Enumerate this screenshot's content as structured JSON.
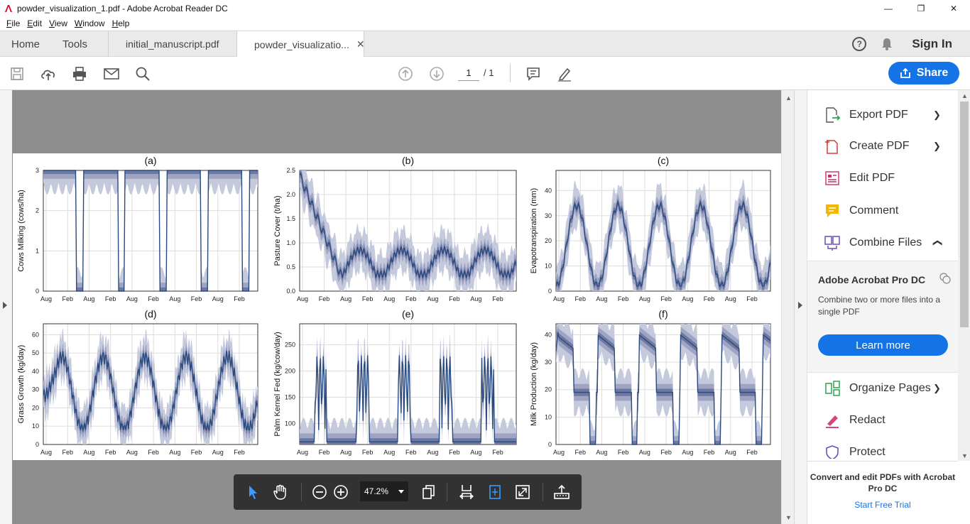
{
  "window": {
    "title": "powder_visualization_1.pdf - Adobe Acrobat Reader DC",
    "minimize": "—",
    "restore": "❐",
    "close": "✕"
  },
  "menu": [
    {
      "label": "File",
      "key": "F",
      "rest": "ile"
    },
    {
      "label": "Edit",
      "key": "E",
      "rest": "dit"
    },
    {
      "label": "View",
      "key": "V",
      "rest": "iew"
    },
    {
      "label": "Window",
      "key": "W",
      "rest": "indow"
    },
    {
      "label": "Help",
      "key": "H",
      "rest": "elp"
    }
  ],
  "tabs": {
    "home": "Home",
    "tools": "Tools",
    "doc1": "initial_manuscript.pdf",
    "doc2": "powder_visualizatio...",
    "doc2_close": "✕"
  },
  "header_right": {
    "help": "?",
    "sign_in": "Sign In"
  },
  "toolbar": {
    "page_current": "1",
    "page_total": "/ 1",
    "share_label": "Share"
  },
  "floatbar": {
    "zoom": "47.2%"
  },
  "right_pane": {
    "items": [
      {
        "label": "Export PDF",
        "icon": "export-pdf-icon",
        "chevron": "down"
      },
      {
        "label": "Create PDF",
        "icon": "create-pdf-icon",
        "chevron": "down"
      },
      {
        "label": "Edit PDF",
        "icon": "edit-pdf-icon"
      },
      {
        "label": "Comment",
        "icon": "comment-icon"
      },
      {
        "label": "Combine Files",
        "icon": "combine-files-icon",
        "chevron": "up"
      },
      {
        "label": "Organize Pages",
        "icon": "organize-pages-icon",
        "chevron": "down"
      },
      {
        "label": "Redact",
        "icon": "redact-icon"
      },
      {
        "label": "Protect",
        "icon": "protect-icon"
      }
    ],
    "promo_title": "Adobe Acrobat Pro DC",
    "promo_desc": "Combine two or more files into a single PDF",
    "promo_button": "Learn more",
    "bottom_text": "Convert and edit PDFs with Acrobat Pro DC",
    "bottom_link": "Start Free Trial"
  },
  "colors": {
    "accent": "#1473e6",
    "line": "#2a4a7f",
    "band_light": "#c5c9dc",
    "band_mid": "#9ea5c4",
    "band_dark": "#6f789f"
  },
  "chart_data": [
    {
      "type": "line",
      "panel": "(a)",
      "ylabel": "Cows Milking (cows/ha)",
      "x_ticks": [
        "Aug",
        "Feb",
        "Aug",
        "Feb",
        "Aug",
        "Feb",
        "Aug",
        "Feb",
        "Aug",
        "Feb"
      ],
      "y_ticks": [
        "0",
        "1",
        "2",
        "3"
      ],
      "ylim": [
        0,
        3
      ],
      "pattern": "cows",
      "shaded_bands": true
    },
    {
      "type": "line",
      "panel": "(b)",
      "ylabel": "Pasture Cover (t/ha)",
      "x_ticks": [
        "Aug",
        "Feb",
        "Aug",
        "Feb",
        "Aug",
        "Feb",
        "Aug",
        "Feb",
        "Aug",
        "Feb"
      ],
      "y_ticks": [
        "0.0",
        "0.5",
        "1.0",
        "1.5",
        "2.0",
        "2.5"
      ],
      "ylim": [
        0,
        2.5
      ],
      "pattern": "pasture",
      "shaded_bands": true
    },
    {
      "type": "line",
      "panel": "(c)",
      "ylabel": "Evapotranspiration (mm)",
      "x_ticks": [
        "Aug",
        "Feb",
        "Aug",
        "Feb",
        "Aug",
        "Feb",
        "Aug",
        "Feb",
        "Aug",
        "Feb"
      ],
      "y_ticks": [
        "0",
        "10",
        "20",
        "30",
        "40"
      ],
      "ylim": [
        0,
        48
      ],
      "pattern": "et",
      "shaded_bands": true
    },
    {
      "type": "line",
      "panel": "(d)",
      "ylabel": "Grass Growth (kg/day)",
      "x_ticks": [
        "Aug",
        "Feb",
        "Aug",
        "Feb",
        "Aug",
        "Feb",
        "Aug",
        "Feb",
        "Aug",
        "Feb"
      ],
      "y_ticks": [
        "0",
        "10",
        "20",
        "30",
        "40",
        "50",
        "60"
      ],
      "ylim": [
        0,
        66
      ],
      "pattern": "grass",
      "shaded_bands": true
    },
    {
      "type": "line",
      "panel": "(e)",
      "ylabel": "Palm Kernel Fed (kg/cow/day)",
      "x_ticks": [
        "Aug",
        "Feb",
        "Aug",
        "Feb",
        "Aug",
        "Feb",
        "Aug",
        "Feb",
        "Aug",
        "Feb"
      ],
      "y_ticks": [
        "100",
        "150",
        "200",
        "250"
      ],
      "ylim": [
        60,
        290
      ],
      "pattern": "pk",
      "shaded_bands": true
    },
    {
      "type": "line",
      "panel": "(f)",
      "ylabel": "Milk Production (kg/day)",
      "x_ticks": [
        "Aug",
        "Feb",
        "Aug",
        "Feb",
        "Aug",
        "Feb",
        "Aug",
        "Feb",
        "Aug",
        "Feb"
      ],
      "y_ticks": [
        "0",
        "10",
        "20",
        "30",
        "40"
      ],
      "ylim": [
        0,
        44
      ],
      "pattern": "milk",
      "shaded_bands": true
    }
  ]
}
